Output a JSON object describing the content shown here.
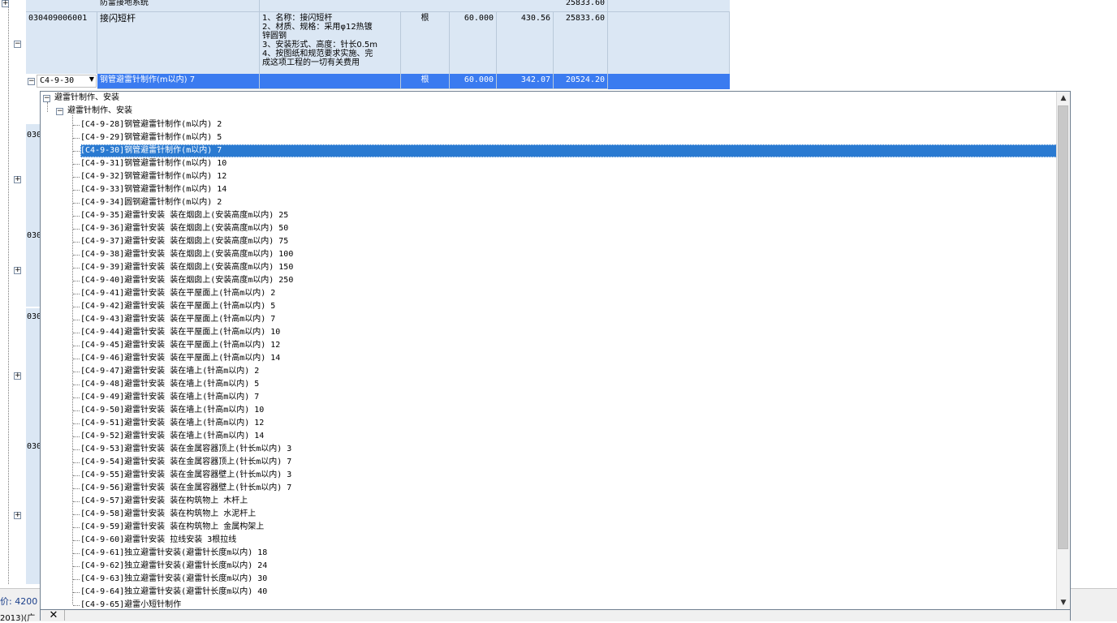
{
  "grid": {
    "top_row": {
      "name": "防雷接地系统",
      "total": "25833.60"
    },
    "item_row": {
      "code": "030409006001",
      "name": "接闪短杆",
      "desc": "1、名称：接闪短杆\n2、材质、规格：采用φ12热镀\n锌圆钢\n3、安装形式、高度：针长0.5m\n4、按图纸和规范要求实施、完\n成这项工程的一切有关费用",
      "unit": "根",
      "qty": "60.000",
      "price": "430.56",
      "total": "25833.60"
    },
    "quota_row": {
      "code": "C4-9-30",
      "name": "钢管避雷针制作(m以内) 7",
      "unit": "根",
      "qty": "60.000",
      "price": "342.07",
      "total": "20524.20"
    },
    "hidden_codes": [
      "030",
      "030",
      "030",
      "030"
    ],
    "status_left": "价: 4200",
    "status_bottom": "2013)(广"
  },
  "dropdown": {
    "root_label": "避雷针制作、安装",
    "group_label": "避雷针制作、安装",
    "selected_index": 2,
    "items": [
      "[C4-9-28]钢管避雷针制作(m以内) 2",
      "[C4-9-29]钢管避雷针制作(m以内) 5",
      "[C4-9-30]钢管避雷针制作(m以内) 7",
      "[C4-9-31]钢管避雷针制作(m以内) 10",
      "[C4-9-32]钢管避雷针制作(m以内) 12",
      "[C4-9-33]钢管避雷针制作(m以内) 14",
      "[C4-9-34]圆钢避雷针制作(m以内) 2",
      "[C4-9-35]避雷针安装 装在烟囱上(安装高度m以内) 25",
      "[C4-9-36]避雷针安装 装在烟囱上(安装高度m以内) 50",
      "[C4-9-37]避雷针安装 装在烟囱上(安装高度m以内) 75",
      "[C4-9-38]避雷针安装 装在烟囱上(安装高度m以内) 100",
      "[C4-9-39]避雷针安装 装在烟囱上(安装高度m以内) 150",
      "[C4-9-40]避雷针安装 装在烟囱上(安装高度m以内) 250",
      "[C4-9-41]避雷针安装 装在平屋面上(针高m以内) 2",
      "[C4-9-42]避雷针安装 装在平屋面上(针高m以内) 5",
      "[C4-9-43]避雷针安装 装在平屋面上(针高m以内) 7",
      "[C4-9-44]避雷针安装 装在平屋面上(针高m以内) 10",
      "[C4-9-45]避雷针安装 装在平屋面上(针高m以内) 12",
      "[C4-9-46]避雷针安装 装在平屋面上(针高m以内) 14",
      "[C4-9-47]避雷针安装 装在墙上(针高m以内) 2",
      "[C4-9-48]避雷针安装 装在墙上(针高m以内) 5",
      "[C4-9-49]避雷针安装 装在墙上(针高m以内) 7",
      "[C4-9-50]避雷针安装 装在墙上(针高m以内) 10",
      "[C4-9-51]避雷针安装 装在墙上(针高m以内) 12",
      "[C4-9-52]避雷针安装 装在墙上(针高m以内) 14",
      "[C4-9-53]避雷针安装 装在金属容器顶上(针长m以内) 3",
      "[C4-9-54]避雷针安装 装在金属容器顶上(针长m以内) 7",
      "[C4-9-55]避雷针安装 装在金属容器壁上(针长m以内) 3",
      "[C4-9-56]避雷针安装 装在金属容器壁上(针长m以内) 7",
      "[C4-9-57]避雷针安装 装在构筑物上 木杆上",
      "[C4-9-58]避雷针安装 装在构筑物上 水泥杆上",
      "[C4-9-59]避雷针安装 装在构筑物上 金属构架上",
      "[C4-9-60]避雷针安装 拉线安装 3根拉线",
      "[C4-9-61]独立避雷针安装(避雷针长度m以内) 18",
      "[C4-9-62]独立避雷针安装(避雷针长度m以内) 24",
      "[C4-9-63]独立避雷针安装(避雷针长度m以内) 30",
      "[C4-9-64]独立避雷针安装(避雷针长度m以内) 40",
      "[C4-9-65]避雷小短针制作"
    ]
  },
  "colors": {
    "row_bg": "#dbe7f4",
    "selected_row": "#3a7bf0",
    "highlight": "#2a7ad1"
  }
}
